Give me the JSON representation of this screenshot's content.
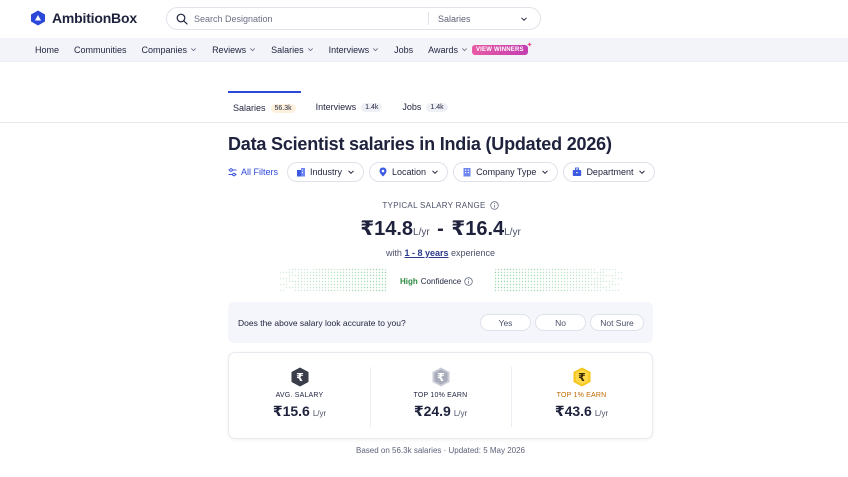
{
  "header": {
    "logo_text": "AmbitionBox",
    "brand_color": "#2c48d8",
    "search": {
      "placeholder": "Search Designation",
      "category": "Salaries"
    }
  },
  "nav": {
    "items": [
      {
        "label": "Home",
        "dropdown": false
      },
      {
        "label": "Communities",
        "dropdown": false
      },
      {
        "label": "Companies",
        "dropdown": true
      },
      {
        "label": "Reviews",
        "dropdown": true
      },
      {
        "label": "Salaries",
        "dropdown": true
      },
      {
        "label": "Interviews",
        "dropdown": true
      },
      {
        "label": "Jobs",
        "dropdown": false
      },
      {
        "label": "Awards",
        "dropdown": true
      }
    ],
    "badge": "VIEW WINNERS"
  },
  "tabs": [
    {
      "label": "Salaries",
      "count": "56.3k",
      "active": true
    },
    {
      "label": "Interviews",
      "count": "1.4k",
      "active": false
    },
    {
      "label": "Jobs",
      "count": "1.4k",
      "active": false
    }
  ],
  "page_title": "Data Scientist salaries in India (Updated 2026)",
  "filters": {
    "all_label": "All Filters",
    "chips": [
      {
        "label": "Industry",
        "icon": "building-icon"
      },
      {
        "label": "Location",
        "icon": "location-pin-icon"
      },
      {
        "label": "Company Type",
        "icon": "office-icon"
      },
      {
        "label": "Department",
        "icon": "briefcase-icon"
      }
    ]
  },
  "salary_range": {
    "label": "TYPICAL SALARY RANGE",
    "min": "₹14.8",
    "max": "₹16.4",
    "unit": "L/yr",
    "dash": "-",
    "experience_prefix": "with",
    "experience_link": "1 - 8 years",
    "experience_suffix": "experience",
    "confidence_high": "High",
    "confidence_rest": "Confidence"
  },
  "feedback": {
    "question": "Does the above salary look accurate to you?",
    "options": [
      "Yes",
      "No",
      "Not Sure"
    ]
  },
  "stats": [
    {
      "label": "AVG. SALARY",
      "value": "₹15.6",
      "unit": "L/yr",
      "coin": "dark"
    },
    {
      "label": "TOP 10% EARN",
      "value": "₹24.9",
      "unit": "L/yr",
      "coin": "silver"
    },
    {
      "label": "TOP 1% EARN",
      "value": "₹43.6",
      "unit": "L/yr",
      "coin": "gold"
    }
  ],
  "footnote": "Based on 56.3k salaries · Updated: 5 May 2026"
}
